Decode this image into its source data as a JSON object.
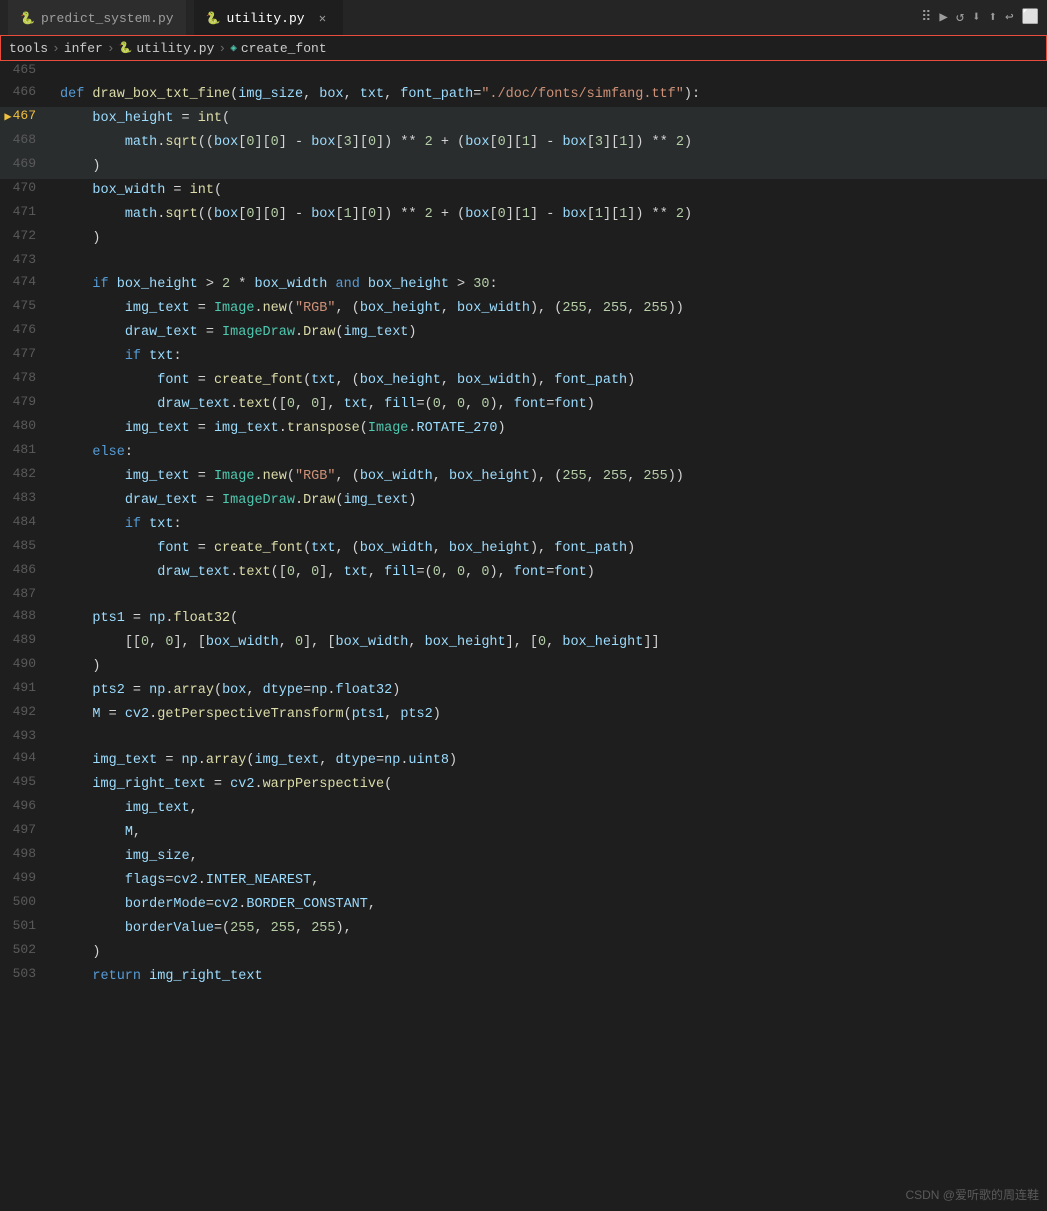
{
  "tabs": [
    {
      "label": "predict_system.py",
      "active": false,
      "icon": "🐍"
    },
    {
      "label": "utility.py",
      "active": true,
      "icon": "🐍"
    }
  ],
  "breadcrumb": [
    "tools",
    "infer",
    "utility.py",
    "create_font"
  ],
  "toolbar_icons": [
    "⠿",
    "▶",
    "↺",
    "⬇",
    "⬆",
    "↩",
    "⬜"
  ],
  "lines": [
    {
      "num": "465",
      "content": "",
      "tokens": []
    },
    {
      "num": "466",
      "content": "def draw_box_txt_fine(img_size, box, txt, font_path=\"./doc/fonts/simfang.ttf\"):",
      "highlight": false
    },
    {
      "num": "467",
      "content": "    box_height = int(",
      "highlight": true,
      "debug": true
    },
    {
      "num": "468",
      "content": "        math.sqrt((box[0][0] - box[3][0]) ** 2 + (box[0][1] - box[3][1]) ** 2)",
      "highlight": true
    },
    {
      "num": "469",
      "content": "    )",
      "highlight": true
    },
    {
      "num": "470",
      "content": "    box_width = int(",
      "highlight": false
    },
    {
      "num": "471",
      "content": "        math.sqrt((box[0][0] - box[1][0]) ** 2 + (box[0][1] - box[1][1]) ** 2)",
      "highlight": false
    },
    {
      "num": "472",
      "content": "    )",
      "highlight": false
    },
    {
      "num": "473",
      "content": "",
      "highlight": false
    },
    {
      "num": "474",
      "content": "    if box_height > 2 * box_width and box_height > 30:",
      "highlight": false
    },
    {
      "num": "475",
      "content": "        img_text = Image.new(\"RGB\", (box_height, box_width), (255, 255, 255))",
      "highlight": false
    },
    {
      "num": "476",
      "content": "        draw_text = ImageDraw.Draw(img_text)",
      "highlight": false
    },
    {
      "num": "477",
      "content": "        if txt:",
      "highlight": false
    },
    {
      "num": "478",
      "content": "            font = create_font(txt, (box_height, box_width), font_path)",
      "highlight": false
    },
    {
      "num": "479",
      "content": "            draw_text.text([0, 0], txt, fill=(0, 0, 0), font=font)",
      "highlight": false
    },
    {
      "num": "480",
      "content": "        img_text = img_text.transpose(Image.ROTATE_270)",
      "highlight": false
    },
    {
      "num": "481",
      "content": "    else:",
      "highlight": false
    },
    {
      "num": "482",
      "content": "        img_text = Image.new(\"RGB\", (box_width, box_height), (255, 255, 255))",
      "highlight": false
    },
    {
      "num": "483",
      "content": "        draw_text = ImageDraw.Draw(img_text)",
      "highlight": false
    },
    {
      "num": "484",
      "content": "        if txt:",
      "highlight": false
    },
    {
      "num": "485",
      "content": "            font = create_font(txt, (box_width, box_height), font_path)",
      "highlight": false
    },
    {
      "num": "486",
      "content": "            draw_text.text([0, 0], txt, fill=(0, 0, 0), font=font)",
      "highlight": false
    },
    {
      "num": "487",
      "content": "",
      "highlight": false
    },
    {
      "num": "488",
      "content": "    pts1 = np.float32(",
      "highlight": false
    },
    {
      "num": "489",
      "content": "        [[0, 0], [box_width, 0], [box_width, box_height], [0, box_height]]",
      "highlight": false
    },
    {
      "num": "490",
      "content": "    )",
      "highlight": false
    },
    {
      "num": "491",
      "content": "    pts2 = np.array(box, dtype=np.float32)",
      "highlight": false
    },
    {
      "num": "492",
      "content": "    M = cv2.getPerspectiveTransform(pts1, pts2)",
      "highlight": false
    },
    {
      "num": "493",
      "content": "",
      "highlight": false
    },
    {
      "num": "494",
      "content": "    img_text = np.array(img_text, dtype=np.uint8)",
      "highlight": false
    },
    {
      "num": "495",
      "content": "    img_right_text = cv2.warpPerspective(",
      "highlight": false
    },
    {
      "num": "496",
      "content": "        img_text,",
      "highlight": false
    },
    {
      "num": "497",
      "content": "        M,",
      "highlight": false
    },
    {
      "num": "498",
      "content": "        img_size,",
      "highlight": false
    },
    {
      "num": "499",
      "content": "        flags=cv2.INTER_NEAREST,",
      "highlight": false
    },
    {
      "num": "500",
      "content": "        borderMode=cv2.BORDER_CONSTANT,",
      "highlight": false
    },
    {
      "num": "501",
      "content": "        borderValue=(255, 255, 255),",
      "highlight": false
    },
    {
      "num": "502",
      "content": "    )",
      "highlight": false
    },
    {
      "num": "503",
      "content": "    return img_right_text",
      "highlight": false
    }
  ],
  "watermark": "CSDN @爱听歌的周连鞋"
}
